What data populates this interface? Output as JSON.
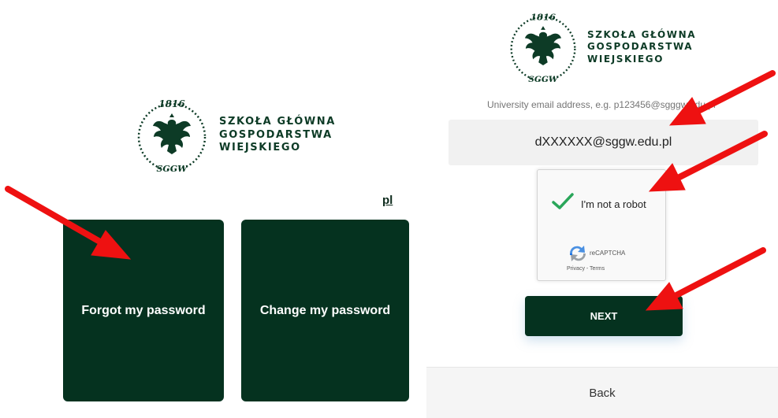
{
  "left_panel": {
    "logo": {
      "year": "1816",
      "initials": "SGGW",
      "name_lines": [
        "SZKOŁA GŁÓWNA",
        "GOSPODARSTWA",
        "WIEJSKIEGO"
      ]
    },
    "language_link": "pl",
    "tiles": {
      "forgot_label": "Forgot my password",
      "change_label": "Change my password"
    }
  },
  "right_panel": {
    "logo": {
      "year": "1816",
      "initials": "SGGW",
      "name_lines": [
        "SZKOŁA GŁÓWNA",
        "GOSPODARSTWA",
        "WIEJSKIEGO"
      ]
    },
    "email_label": "University email address, e.g. p123456@sgggw.edu.pl",
    "email_value": "dXXXXXX@sggw.edu.pl",
    "captcha": {
      "checkbox_label": "I'm not a robot",
      "brand": "reCAPTCHA",
      "links": "Privacy - Terms",
      "checked": true
    },
    "next_label": "NEXT",
    "back_label": "Back"
  },
  "colors": {
    "brand_dark_green": "#05321f",
    "annotation_red": "#ee1111",
    "check_green": "#2aa65a"
  },
  "annotations": {
    "arrow_count": 5
  }
}
